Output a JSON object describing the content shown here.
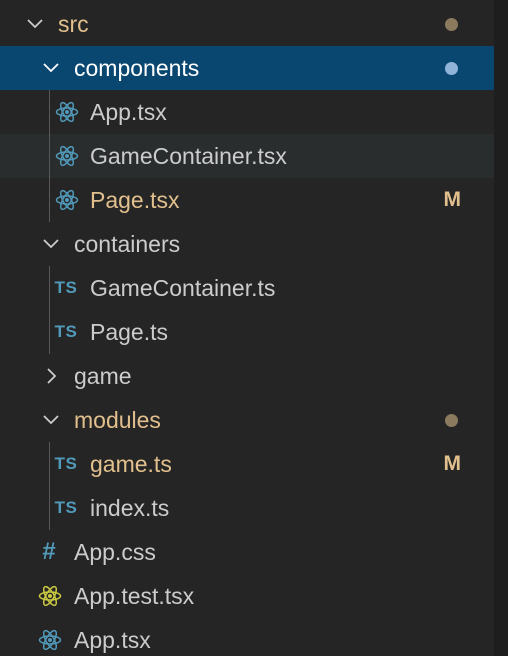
{
  "colors": {
    "modified": "#e2c08d",
    "folder_dot_dim": "#8b7a5e",
    "folder_dot_selected": "#8fb4d8",
    "selection": "#094771",
    "react_icon": "#519aba",
    "react_test_icon": "#cbcb41",
    "ts_icon": "#519aba"
  },
  "tree": {
    "src": {
      "label": "src",
      "icon": "chevron-down-icon",
      "decoration": "dot"
    },
    "components": {
      "label": "components",
      "icon": "chevron-down-icon",
      "decoration": "dot"
    },
    "components_app_tsx": {
      "label": "App.tsx",
      "icon": "react-icon"
    },
    "components_gamecontainer_tsx": {
      "label": "GameContainer.tsx",
      "icon": "react-icon"
    },
    "components_page_tsx": {
      "label": "Page.tsx",
      "icon": "react-icon",
      "badge": "M"
    },
    "containers": {
      "label": "containers",
      "icon": "chevron-down-icon"
    },
    "containers_gamecontainer_ts": {
      "label": "GameContainer.ts",
      "icon": "typescript-icon",
      "icon_text": "TS"
    },
    "containers_page_ts": {
      "label": "Page.ts",
      "icon": "typescript-icon",
      "icon_text": "TS"
    },
    "game": {
      "label": "game",
      "icon": "chevron-right-icon"
    },
    "modules": {
      "label": "modules",
      "icon": "chevron-down-icon",
      "decoration": "dot"
    },
    "modules_game_ts": {
      "label": "game.ts",
      "icon": "typescript-icon",
      "icon_text": "TS",
      "badge": "M"
    },
    "modules_index_ts": {
      "label": "index.ts",
      "icon": "typescript-icon",
      "icon_text": "TS"
    },
    "app_css": {
      "label": "App.css",
      "icon": "css-hash-icon",
      "icon_text": "#"
    },
    "app_test_tsx": {
      "label": "App.test.tsx",
      "icon": "react-test-icon"
    },
    "app_tsx": {
      "label": "App.tsx",
      "icon": "react-icon"
    }
  }
}
